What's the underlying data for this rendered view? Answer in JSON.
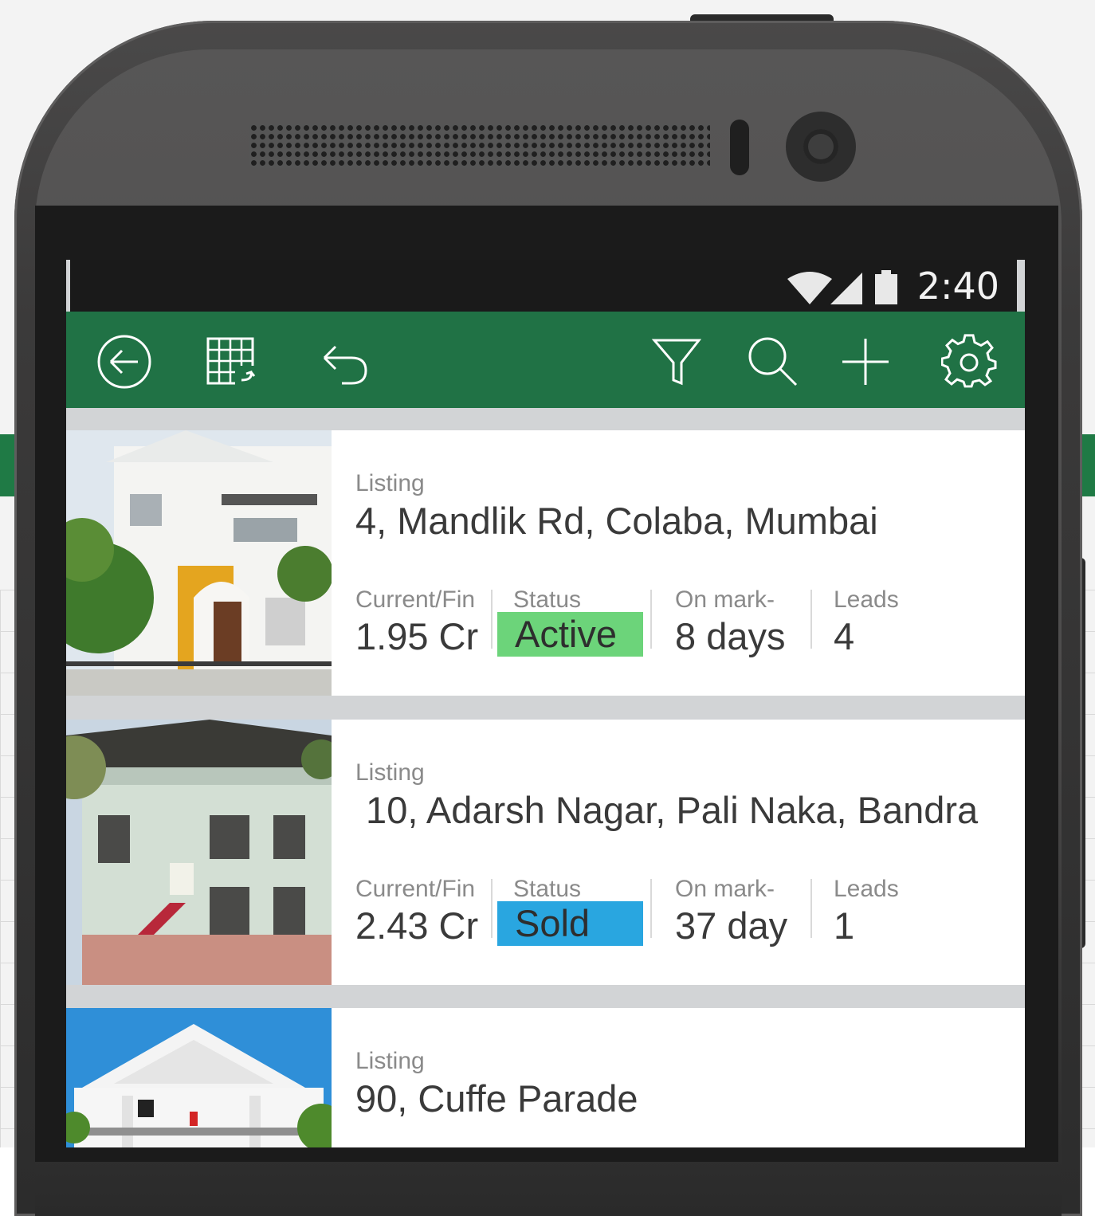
{
  "statusbar": {
    "time": "2:40",
    "icons": [
      "wifi-icon",
      "signal-icon",
      "battery-icon"
    ]
  },
  "toolbar": {
    "buttons": [
      "back-icon",
      "sheet-icon",
      "undo-icon",
      "filter-icon",
      "search-icon",
      "add-icon",
      "settings-icon"
    ]
  },
  "colors": {
    "appbar": "#207245",
    "active": "#6cd47a",
    "sold": "#29a6e0",
    "screen_bg": "#d2d4d6"
  },
  "listings": [
    {
      "label": "Listing",
      "address": "4, Mandlik Rd, Colaba, Mumbai",
      "price_label": "Current/Fin",
      "price": "1.95 Cr",
      "status_label": "Status",
      "status": "Active",
      "market_label": "On mark-",
      "market": "8 days",
      "leads_label": "Leads",
      "leads": "4"
    },
    {
      "label": "Listing",
      "address": " 10, Adarsh Nagar, Pali Naka, Bandra",
      "price_label": "Current/Fin",
      "price": "2.43 Cr",
      "status_label": "Status",
      "status": "Sold",
      "market_label": "On mark-",
      "market": "37 day",
      "leads_label": "Leads",
      "leads": "1"
    },
    {
      "label": "Listing",
      "address": "90, Cuffe Parade"
    }
  ]
}
